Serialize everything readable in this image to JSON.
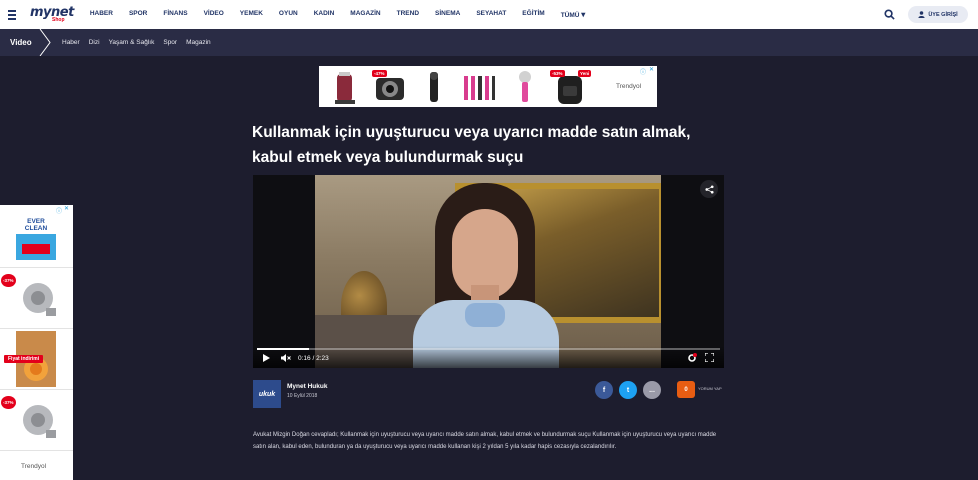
{
  "nav": {
    "logo": "mynet",
    "logo_sub": "Shop",
    "items": [
      "HABER",
      "SPOR",
      "FİNANS",
      "VİDEO",
      "YEMEK",
      "OYUN",
      "KADIN",
      "MAGAZİN",
      "TREND",
      "SİNEMA",
      "SEYAHAT",
      "EĞİTİM"
    ],
    "more": "TÜMÜ",
    "login": "ÜYE GİRİŞİ"
  },
  "section": {
    "title": "Video",
    "items": [
      "Haber",
      "Dizi",
      "Yaşam & Sağlık",
      "Spor",
      "Magazin"
    ]
  },
  "top_ad": {
    "brand": "Trendyol",
    "badges": [
      "-47%",
      "-53%",
      "Yeni"
    ]
  },
  "article": {
    "headline": "Kullanmak için uyuşturucu veya uyarıcı madde satın almak, kabul etmek veya bulundurmak suçu",
    "author": "Mynet Hukuk",
    "avatar_text": "ukuk",
    "date": "10 Eylül 2018",
    "comment_count": "0",
    "comment_label": "YORUM YAP",
    "description": "Avukat Mizgin Doğan cevapladı; Kullanmak için uyuşturucu veya uyarıcı madde satın almak, kabul etmek ve bulundurmak suçu Kullanmak için uyuşturucu veya uyarıcı madde satın alan, kabul eden, bulunduran ya da uyuşturucu veya uyarıcı madde kullanan kişi 2 yıldan 5 yıla kadar hapis cezasıyla cezalandırılır."
  },
  "video": {
    "time": "0:16 / 2:23",
    "progress": 0.112
  },
  "share": {
    "facebook": "f",
    "twitter": "t",
    "more": "..."
  },
  "left_ad": {
    "product1": "EVER CLEAN",
    "badge1": "-37%",
    "badge2": "Fiyat indirimi",
    "badge3": "-37%",
    "brand": "Trendyol"
  },
  "colors": {
    "navy": "#213466",
    "bg": "#1d1d2e",
    "accent": "#e3001b",
    "facebook": "#3b5998",
    "twitter": "#1da1f2",
    "comment": "#e85d12"
  }
}
